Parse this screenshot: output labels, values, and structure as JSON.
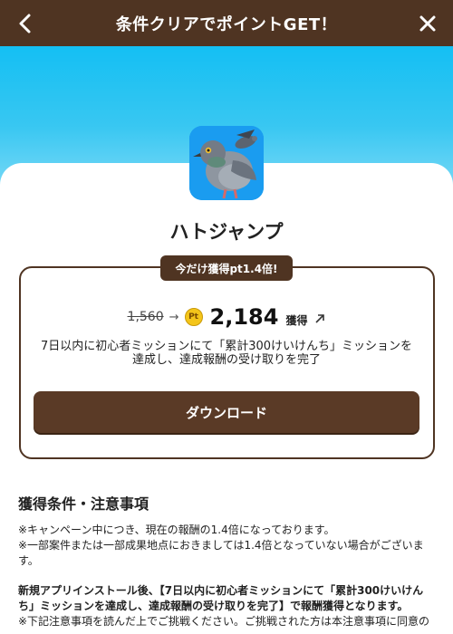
{
  "header": {
    "title": "条件クリアでポイントGET！"
  },
  "app": {
    "name": "ハトジャンプ",
    "icon": "pigeon-app-icon"
  },
  "offer": {
    "promo_tag": "今だけ獲得pt1.4倍!",
    "old_points": "1,560",
    "new_points": "2,184",
    "points_suffix": "獲得",
    "coin_label": "Pt",
    "condition": "7日以内に初心者ミッションにて「累計300けいけんち」ミッションを達成し、達成報酬の受け取りを完了",
    "download_label": "ダウンロード"
  },
  "notes": {
    "title": "獲得条件・注意事項",
    "line1": "※キャンペーン中につき、現在の報酬の1.4倍になっております。",
    "line2": "※一部案件または一部成果地点におきましては1.4倍となっていない場合がございます。",
    "bold_para": "新規アプリインストール後、【7日以内に初心者ミッションにて「累計300けいけんち」ミッションを達成し、達成報酬の受け取りを完了】で報酬獲得となります。",
    "line3": "※下記注意事項を読んだ上でご挑戦ください。ご挑戦された方は本注意事項に同意の"
  },
  "colors": {
    "brand_brown": "#4f3422",
    "hero_blue": "#14bff3",
    "coin_yellow": "#f4c51a"
  }
}
